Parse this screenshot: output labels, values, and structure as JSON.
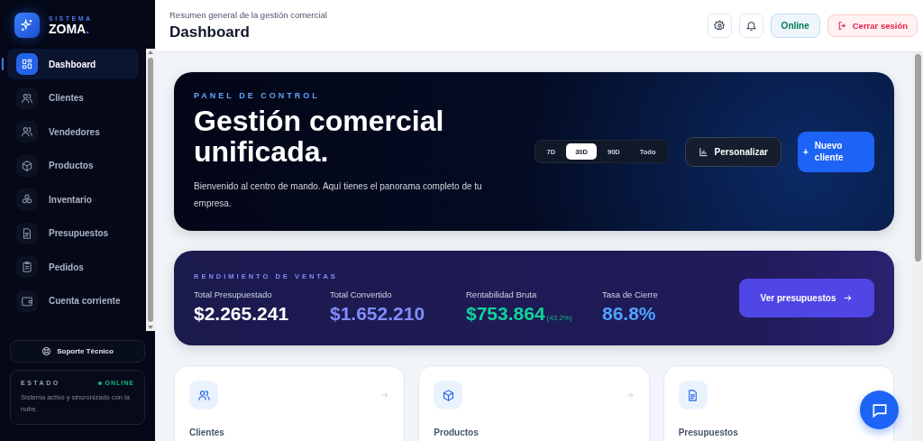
{
  "brand": {
    "kicker": "SISTEMA",
    "name": "ZOMA",
    "dot": "."
  },
  "sidebar": {
    "items": [
      {
        "label": "Dashboard",
        "selected": true
      },
      {
        "label": "Clientes",
        "selected": false
      },
      {
        "label": "Vendedores",
        "selected": false
      },
      {
        "label": "Productos",
        "selected": false
      },
      {
        "label": "Inventario",
        "selected": false
      },
      {
        "label": "Presupuestos",
        "selected": false
      },
      {
        "label": "Pedidos",
        "selected": false
      },
      {
        "label": "Cuenta corriente",
        "selected": false
      }
    ],
    "support": "Soporte Técnico",
    "status": {
      "title": "ESTADO",
      "state": "ONLINE",
      "text": "Sistema activo y sincronizado con la nube."
    }
  },
  "header": {
    "subtitle": "Resumen general de la gestión comercial",
    "title": "Dashboard",
    "status": "Online",
    "logout": "Cerrar sesión"
  },
  "hero": {
    "kicker": "PANEL DE CONTROL",
    "title": "Gestión comercial unificada.",
    "text": "Bienvenido al centro de mando. Aquí tienes el panorama completo de tu empresa.",
    "ranges": [
      {
        "label": "7D",
        "selected": false
      },
      {
        "label": "30D",
        "selected": true
      },
      {
        "label": "90D",
        "selected": false
      },
      {
        "label": "Todo",
        "selected": false
      }
    ],
    "customize": "Personalizar",
    "plus": "+",
    "new": "Nuevo cliente"
  },
  "sales": {
    "kicker": "RENDIMIENTO DE VENTAS",
    "stats": [
      {
        "label": "Total Presupuestado",
        "value": "$2.265.241",
        "color": "#ffffff"
      },
      {
        "label": "Total Convertido",
        "value": "$1.652.210",
        "color": "#818cf8"
      },
      {
        "label": "Rentabilidad Bruta",
        "value": "$753.864",
        "note": "(43.2%)",
        "color": "#10d39a"
      },
      {
        "label": "Tasa de Cierre",
        "value": "86.8%",
        "color": "#4fa3ff"
      }
    ],
    "button": "Ver presupuestos"
  },
  "cards": [
    {
      "label": "Clientes",
      "arrow": true
    },
    {
      "label": "Productos",
      "arrow": true
    },
    {
      "label": "Presupuestos",
      "arrow": false
    }
  ]
}
